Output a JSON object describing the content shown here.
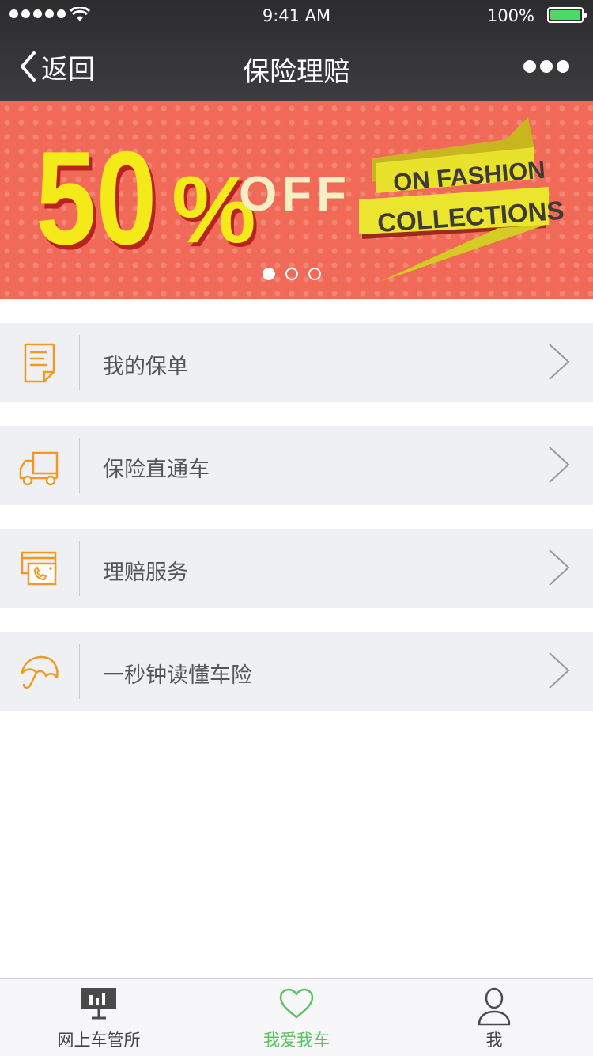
{
  "status_bar": {
    "time": "9:41 AM",
    "battery": "100%"
  },
  "nav": {
    "back_label": "返回",
    "title": "保险理赔"
  },
  "banner": {
    "big_text": "50",
    "percent": "%",
    "off_text": "OFF",
    "ribbon_line1": "ON FASHION",
    "ribbon_line2": "COLLECTIONS",
    "active_slide": 1,
    "slide_count": 3
  },
  "menu": {
    "items": [
      {
        "label": "我的保单",
        "icon": "policy-document-icon"
      },
      {
        "label": "保险直通车",
        "icon": "delivery-truck-icon"
      },
      {
        "label": "理赔服务",
        "icon": "claims-phone-icon"
      },
      {
        "label": "一秒钟读懂车险",
        "icon": "umbrella-icon"
      }
    ]
  },
  "tabbar": {
    "tabs": [
      {
        "label": "网上车管所",
        "icon": "billboard-chart-icon"
      },
      {
        "label": "我爱我车",
        "icon": "heart-icon"
      },
      {
        "label": "我",
        "icon": "person-icon"
      }
    ],
    "active_tab": 1
  },
  "colors": {
    "icon_orange": "#f29a1f",
    "active_green": "#5ac262",
    "banner_red": "#f06a57",
    "banner_yellow": "#f4ea1a"
  }
}
